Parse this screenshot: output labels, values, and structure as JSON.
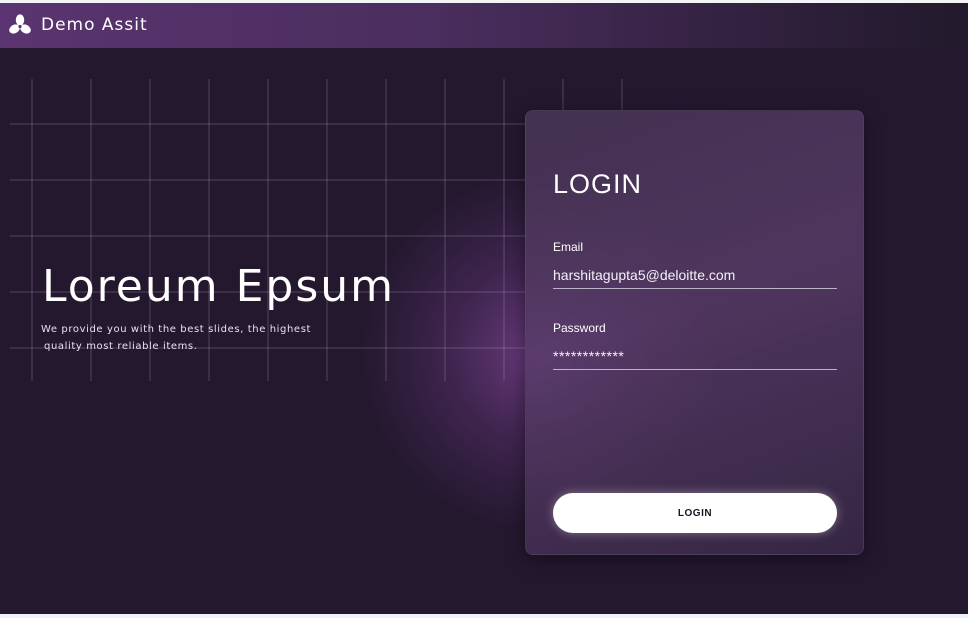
{
  "app": {
    "brand_name": "Demo Assit",
    "logo_icon": "three-petal-logo-icon",
    "colors": {
      "background": "#24182f",
      "topbar_accent": "#5a3470",
      "glow": "#76408c",
      "button": "#ffffff"
    }
  },
  "hero": {
    "title": "Loreum Epsum",
    "subtitle_line1": "We provide you with the best slides, the highest",
    "subtitle_line2": "quality most reliable items."
  },
  "login": {
    "title": "LOGIN",
    "email_label": "Email",
    "email_value": "harshitagupta5@deloitte.com",
    "password_label": "Password",
    "password_value": "************",
    "button_label": "LOGIN"
  }
}
